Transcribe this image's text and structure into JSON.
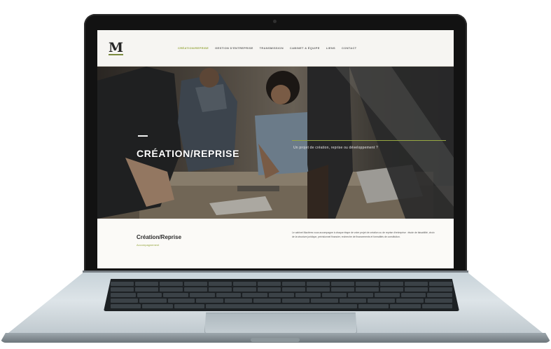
{
  "site": {
    "logo": "M",
    "nav": [
      {
        "label": "CRÉATION/REPRISE",
        "active": true
      },
      {
        "label": "GESTION D'ENTREPRISE",
        "active": false
      },
      {
        "label": "TRANSMISSION",
        "active": false
      },
      {
        "label": "CABINET & ÉQUIPE",
        "active": false
      },
      {
        "label": "LIENS",
        "active": false
      },
      {
        "label": "CONTACT",
        "active": false
      }
    ],
    "hero": {
      "title": "CRÉATION/REPRISE",
      "subtitle": "Un projet de création, reprise ou développement ?"
    },
    "intro": {
      "title": "Création/Reprise",
      "tag": "Accompagnement",
      "text": "Le cabinet Mazières vous accompagne à chaque étape de votre projet de création ou de reprise d'entreprise : étude de faisabilité, choix de la structure juridique, prévisionnel financier, recherche de financements et formalités de constitution."
    }
  },
  "colors": {
    "accent": "#98a843",
    "bezel": "#121212",
    "chassis": "#c8d3d9"
  }
}
